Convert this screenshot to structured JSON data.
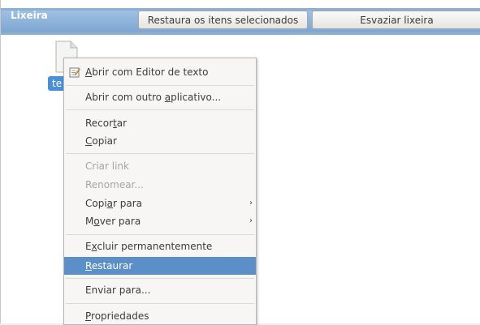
{
  "trash_bar": {
    "title": "Lixeira",
    "restore_button": "Restaura os itens selecionados",
    "empty_button": "Esvaziar lixeira"
  },
  "file": {
    "label": "te",
    "icon": "text-file-icon"
  },
  "context_menu": {
    "open_text_editor": {
      "pre": "",
      "key": "A",
      "post": "brir com Editor de texto",
      "icon": "text-editor-icon"
    },
    "open_other_app": {
      "pre": "Abrir com outro ",
      "key": "a",
      "post": "plicativo..."
    },
    "cut": {
      "pre": "Recor",
      "key": "t",
      "post": "ar"
    },
    "copy": {
      "pre": "",
      "key": "C",
      "post": "opiar"
    },
    "create_link": "Criar link",
    "rename": "Renomear...",
    "copy_to": {
      "pre": "Copi",
      "key": "a",
      "post": "r para"
    },
    "move_to": {
      "pre": "M",
      "key": "o",
      "post": "ver para"
    },
    "delete_perm": {
      "pre": "E",
      "key": "x",
      "post": "cluir permanentemente"
    },
    "restore": {
      "pre": "",
      "key": "R",
      "post": "estaurar"
    },
    "send_to": "Enviar para...",
    "properties": {
      "pre": "",
      "key": "P",
      "post": "ropriedades"
    },
    "submenu_arrow": "›"
  }
}
